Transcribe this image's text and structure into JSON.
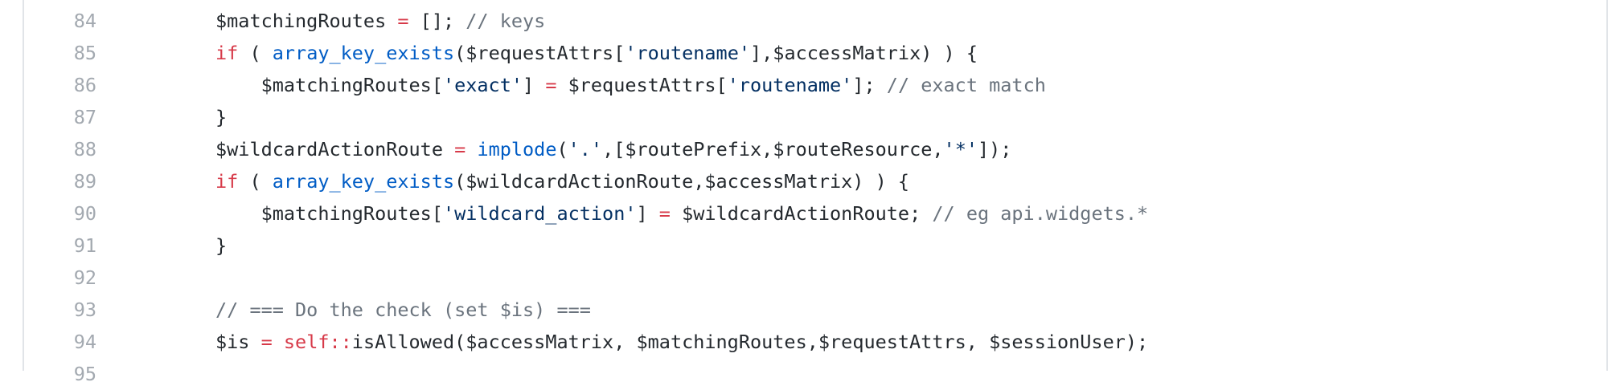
{
  "colors": {
    "keyword": "#d73a49",
    "function": "#005cc5",
    "string": "#032f62",
    "comment": "#6a737d",
    "text": "#24292e",
    "line_number": "#a3a9b0",
    "border": "#e1e4e8"
  },
  "code": {
    "lines": [
      {
        "number": "84",
        "tokens": [
          {
            "t": "$matchingRoutes ",
            "c": "plain"
          },
          {
            "t": "=",
            "c": "op"
          },
          {
            "t": " []; ",
            "c": "plain"
          },
          {
            "t": "// keys",
            "c": "com"
          }
        ]
      },
      {
        "number": "85",
        "tokens": [
          {
            "t": "if",
            "c": "kw"
          },
          {
            "t": " ( ",
            "c": "plain"
          },
          {
            "t": "array_key_exists",
            "c": "fn"
          },
          {
            "t": "($requestAttrs[",
            "c": "plain"
          },
          {
            "t": "'routename'",
            "c": "str"
          },
          {
            "t": "],$accessMatrix) ) {",
            "c": "plain"
          }
        ]
      },
      {
        "number": "86",
        "tokens": [
          {
            "t": "    $matchingRoutes[",
            "c": "plain"
          },
          {
            "t": "'exact'",
            "c": "str"
          },
          {
            "t": "] ",
            "c": "plain"
          },
          {
            "t": "=",
            "c": "op"
          },
          {
            "t": " $requestAttrs[",
            "c": "plain"
          },
          {
            "t": "'routename'",
            "c": "str"
          },
          {
            "t": "]; ",
            "c": "plain"
          },
          {
            "t": "// exact match",
            "c": "com"
          }
        ]
      },
      {
        "number": "87",
        "tokens": [
          {
            "t": "}",
            "c": "plain"
          }
        ]
      },
      {
        "number": "88",
        "tokens": [
          {
            "t": "$wildcardActionRoute ",
            "c": "plain"
          },
          {
            "t": "=",
            "c": "op"
          },
          {
            "t": " ",
            "c": "plain"
          },
          {
            "t": "implode",
            "c": "fn"
          },
          {
            "t": "(",
            "c": "plain"
          },
          {
            "t": "'.'",
            "c": "str"
          },
          {
            "t": ",[$routePrefix,$routeResource,",
            "c": "plain"
          },
          {
            "t": "'*'",
            "c": "str"
          },
          {
            "t": "]);",
            "c": "plain"
          }
        ]
      },
      {
        "number": "89",
        "tokens": [
          {
            "t": "if",
            "c": "kw"
          },
          {
            "t": " ( ",
            "c": "plain"
          },
          {
            "t": "array_key_exists",
            "c": "fn"
          },
          {
            "t": "($wildcardActionRoute,$accessMatrix) ) {",
            "c": "plain"
          }
        ]
      },
      {
        "number": "90",
        "tokens": [
          {
            "t": "    $matchingRoutes[",
            "c": "plain"
          },
          {
            "t": "'wildcard_action'",
            "c": "str"
          },
          {
            "t": "] ",
            "c": "plain"
          },
          {
            "t": "=",
            "c": "op"
          },
          {
            "t": " $wildcardActionRoute; ",
            "c": "plain"
          },
          {
            "t": "// eg api.widgets.*",
            "c": "com"
          }
        ]
      },
      {
        "number": "91",
        "tokens": [
          {
            "t": "}",
            "c": "plain"
          }
        ]
      },
      {
        "number": "92",
        "tokens": []
      },
      {
        "number": "93",
        "tokens": [
          {
            "t": "// === Do the check (set $is) ===",
            "c": "com"
          }
        ]
      },
      {
        "number": "94",
        "tokens": [
          {
            "t": "$is ",
            "c": "plain"
          },
          {
            "t": "=",
            "c": "op"
          },
          {
            "t": " ",
            "c": "plain"
          },
          {
            "t": "self::",
            "c": "kw"
          },
          {
            "t": "isAllowed($accessMatrix, $matchingRoutes,$requestAttrs, $sessionUser);",
            "c": "plain"
          }
        ]
      },
      {
        "number": "95",
        "tokens": []
      }
    ]
  }
}
